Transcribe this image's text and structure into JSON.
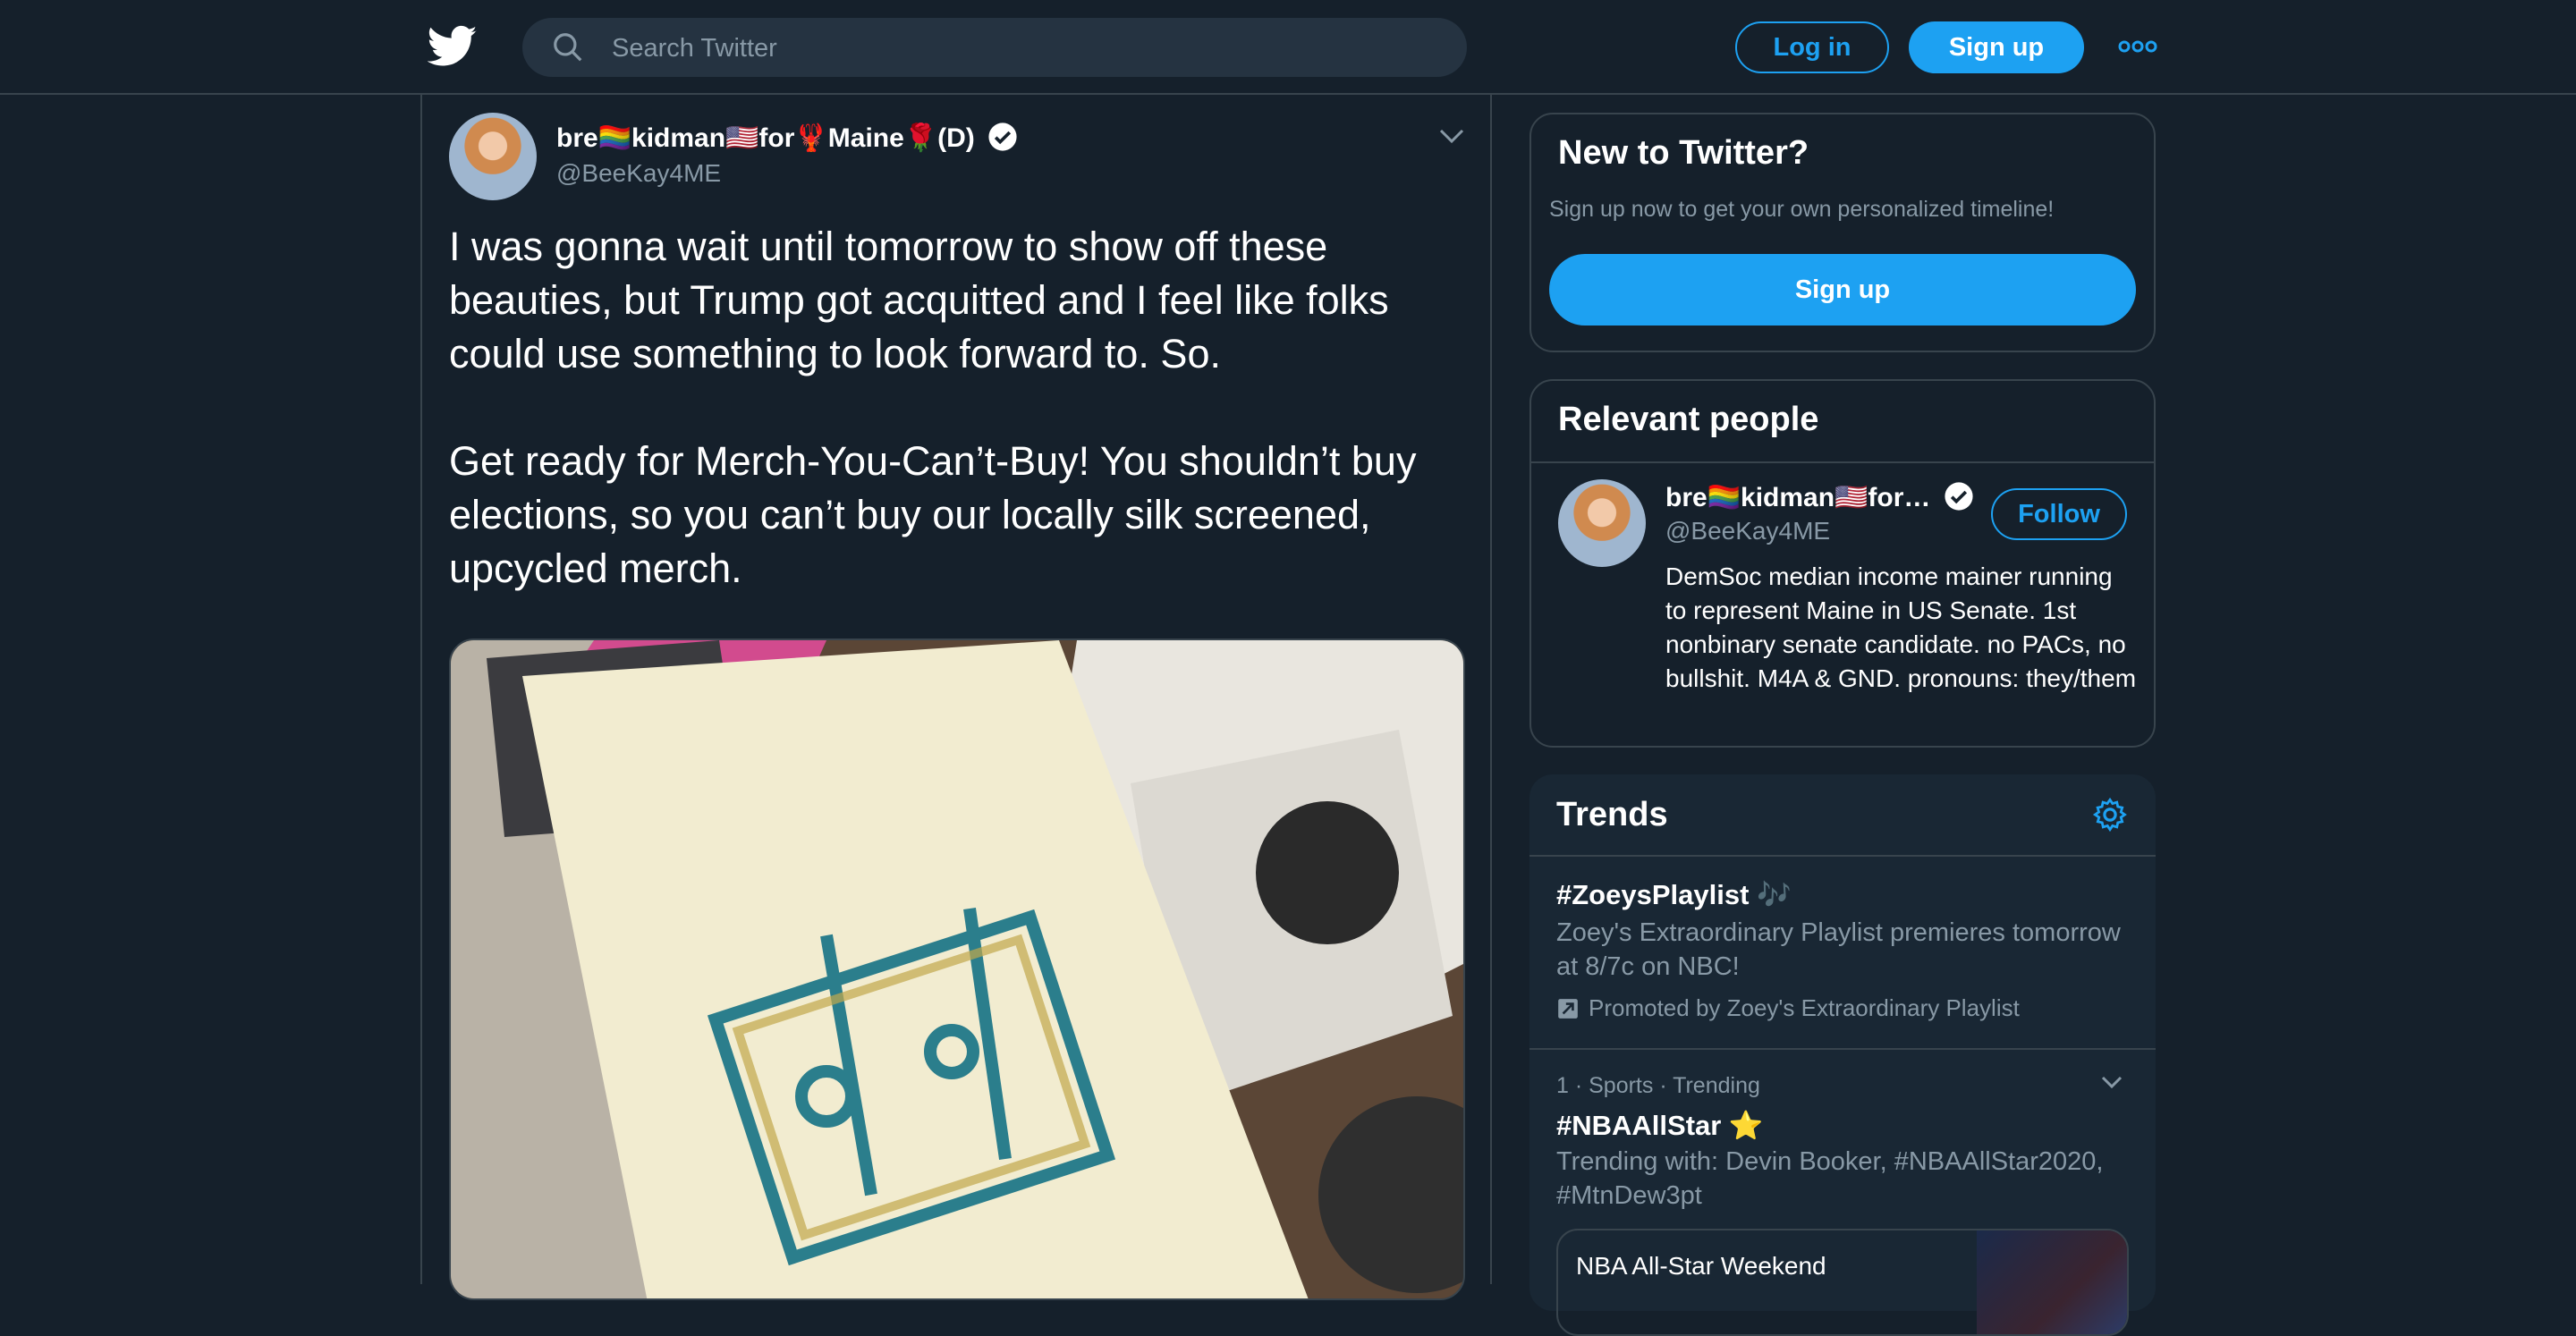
{
  "header": {
    "search_placeholder": "Search Twitter",
    "login_label": "Log in",
    "signup_label": "Sign up"
  },
  "tweet": {
    "author_name": "bre🏳️‍🌈kidman🇺🇸for🦞Maine🌹(D)",
    "author_handle": "@BeeKay4ME",
    "text": "I was gonna wait until tomorrow to show off these beauties, but Trump got acquitted and I feel like folks could use something to look forward to. So.\n\nGet ready for Merch-You-Can’t-Buy! You shouldn’t buy elections, so you can’t buy our locally silk screened, upcycled merch."
  },
  "new_to_twitter": {
    "title": "New to Twitter?",
    "subtitle": "Sign up now to get your own personalized timeline!",
    "signup_label": "Sign up"
  },
  "relevant_people": {
    "title": "Relevant people",
    "name": "bre🏳️‍🌈kidman🇺🇸for…",
    "handle": "@BeeKay4ME",
    "follow_label": "Follow",
    "bio": "DemSoc median income mainer running to represent Maine in US Senate. 1st nonbinary senate candidate. no PACs, no bullshit. M4A & GND. pronouns: they/them"
  },
  "trends": {
    "title": "Trends",
    "items": [
      {
        "title": "#ZoeysPlaylist 🎶",
        "description": "Zoey's Extraordinary Playlist premieres tomorrow at 8/7c on NBC!",
        "promoted": "Promoted by Zoey's Extraordinary Playlist"
      },
      {
        "meta": "1 · Sports · Trending",
        "title": "#NBAAllStar ⭐",
        "description": "Trending with: Devin Booker, #NBAAllStar2020, #MtnDew3pt",
        "news": "NBA All-Star Weekend"
      }
    ]
  },
  "colors": {
    "background": "#15202b",
    "accent": "#1da1f2",
    "border": "#38444d",
    "secondary_text": "#8899a6",
    "trends_background": "#192734"
  }
}
